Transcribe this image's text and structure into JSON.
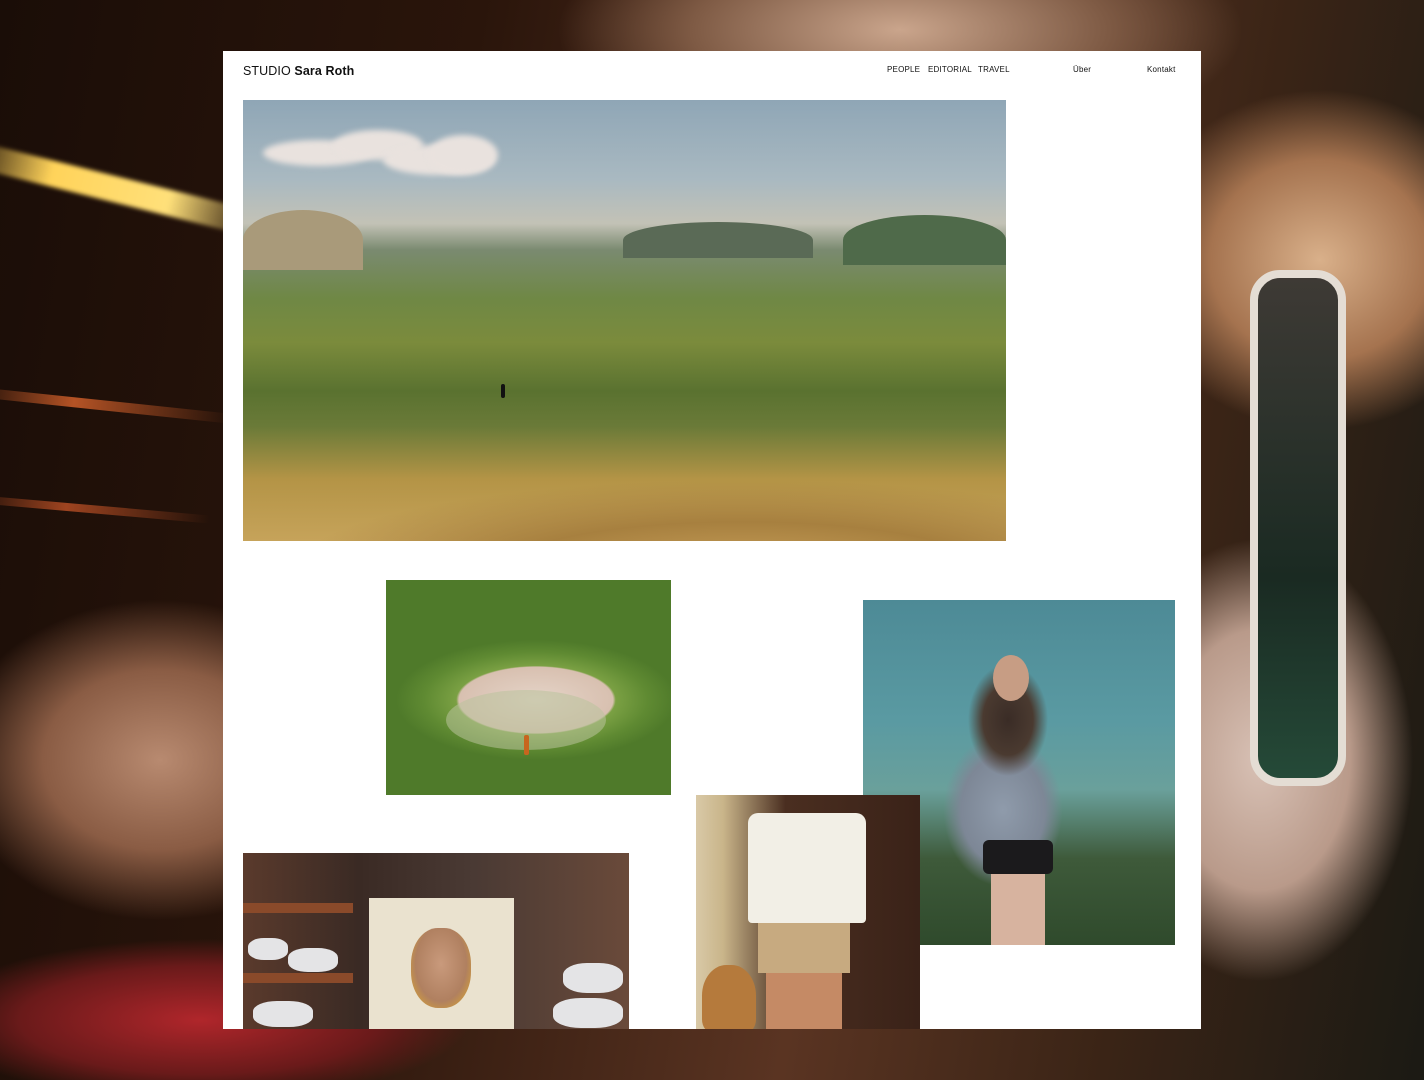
{
  "site": {
    "brand_prefix": "STUDIO",
    "brand_name": "Sara Roth"
  },
  "nav": {
    "people": "PEOPLE",
    "editorial": "EDITORIAL",
    "travel": "TRAVEL",
    "about": "Über",
    "contact": "Kontakt"
  }
}
